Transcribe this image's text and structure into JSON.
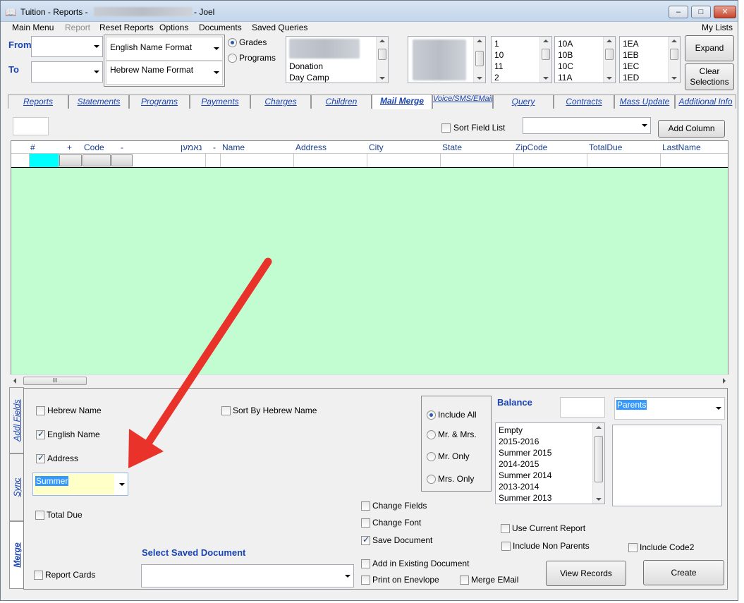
{
  "window": {
    "title_prefix": "Tuition - Reports -",
    "title_user": "- Joel",
    "minimize_glyph": "–",
    "maximize_glyph": "□",
    "close_glyph": "✕",
    "app_icon": "book-icon"
  },
  "menu": {
    "items": [
      "Main Menu",
      "Report",
      "Reset Reports",
      "Options",
      "Documents",
      "Saved Queries"
    ],
    "right": "My Lists"
  },
  "filters": {
    "from_label": "From",
    "to_label": "To",
    "from_value": "",
    "to_value": "",
    "name_format_english": "English Name Format",
    "name_format_hebrew": "Hebrew Name Format",
    "grades_label": "Grades",
    "programs_label": "Programs",
    "selected_radio": "Grades",
    "programs_list": [
      "Donation",
      "Day Camp"
    ],
    "grades_list": [
      "1",
      "10",
      "11",
      "2"
    ],
    "classes_list": [
      "10A",
      "10B",
      "10C",
      "11A"
    ],
    "sections_list": [
      "1EA",
      "1EB",
      "1EC",
      "1ED"
    ],
    "expand_label": "Expand",
    "clear_label_1": "Clear",
    "clear_label_2": "Selections"
  },
  "tabs": [
    "Reports",
    "Statements",
    "Programs",
    "Payments",
    "Charges",
    "Children",
    "Mail Merge",
    "Voice/SMS/EMail",
    "Query",
    "Contracts",
    "Mass Update",
    "Additional Info"
  ],
  "active_tab": "Mail Merge",
  "toolbar": {
    "sort_field_list": "Sort Field List",
    "add_column": "Add Column"
  },
  "grid": {
    "columns": [
      "#",
      "+",
      "Code",
      "-",
      "נאמען",
      "-",
      "Name",
      "Address",
      "City",
      "State",
      "ZipCode",
      "TotalDue",
      "LastName"
    ],
    "scroll_glyph": "III",
    "row_color": "#c2fdd1",
    "selected_cell_color": "#00ffff"
  },
  "side_tabs": [
    "Addl Fields",
    "Sync",
    "Merge"
  ],
  "merge": {
    "hebrew_name": "Hebrew Name",
    "english_name": "English Name",
    "address": "Address",
    "sort_by_hebrew": "Sort By Hebrew Name",
    "season_value": "Summer",
    "total_due": "Total Due",
    "report_cards": "Report Cards",
    "select_saved_document": "Select Saved Document",
    "include_all": "Include All",
    "mr_mrs": "Mr. & Mrs.",
    "mr_only": "Mr. Only",
    "mrs_only": "Mrs. Only",
    "balance_label": "Balance",
    "parents_value": "Parents",
    "balance_list": [
      "Empty",
      "2015-2016",
      "Summer 2015",
      "2014-2015",
      "Summer 2014",
      "2013-2014",
      "Summer 2013"
    ],
    "change_fields": "Change Fields",
    "change_font": "Change Font",
    "save_document": "Save Document",
    "add_existing": "Add in Existing Document",
    "print_envelope": "Print on Enevlope",
    "merge_email": "Merge EMail",
    "use_current_report": "Use Current Report",
    "include_non_parents": "Include Non Parents",
    "include_code2": "Include Code2",
    "view_records": "View Records",
    "create": "Create"
  },
  "annotation": {
    "arrow_color": "#e8322a"
  }
}
